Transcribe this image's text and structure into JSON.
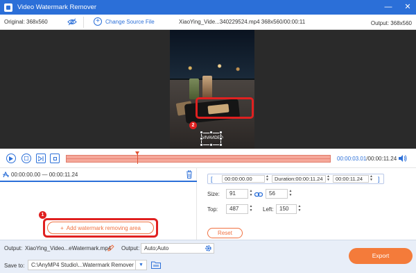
{
  "window": {
    "title": "Video Watermark Remover",
    "minimize_icon": "minimize-icon",
    "close_icon": "close-icon"
  },
  "infobar": {
    "original": "Original: 368x560",
    "change_source": "Change Source File",
    "file_info": "XiaoYing_Vide...340229524.mp4     368x560/00:00:11",
    "output": "Output: 368x560"
  },
  "preview": {
    "watermark_text": "VIVAVIDEO"
  },
  "callouts": {
    "one": "1",
    "two": "2"
  },
  "controls": {
    "current_time": "00:00:03.01",
    "total_time": "/00:00:11.24",
    "progress": 0.27
  },
  "segment": {
    "time_range": "00:00:00.00 — 00:00:11.24"
  },
  "add_area_label": "Add watermark removing area",
  "settings": {
    "start": "00:00:00.00",
    "duration_label": "Duration:00:00:11.24",
    "end": "00:00:11.24",
    "size_label": "Size:",
    "size_w": "91",
    "size_h": "56",
    "top_label": "Top:",
    "top_value": "487",
    "left_label": "Left:",
    "left_value": "150",
    "reset_label": "Reset"
  },
  "bottom": {
    "output_label": "Output:",
    "output_name": "XiaoYing_Video...eWatermark.mp4",
    "output_format_label": "Output:",
    "output_format": "Auto;Auto",
    "save_to_label": "Save to:",
    "save_path": "C:\\AnyMP4 Studio\\...Watermark Remover",
    "export_label": "Export"
  },
  "colors": {
    "accent": "#2b6fd8",
    "orange": "#f47b3a",
    "callout_red": "#e02020"
  }
}
